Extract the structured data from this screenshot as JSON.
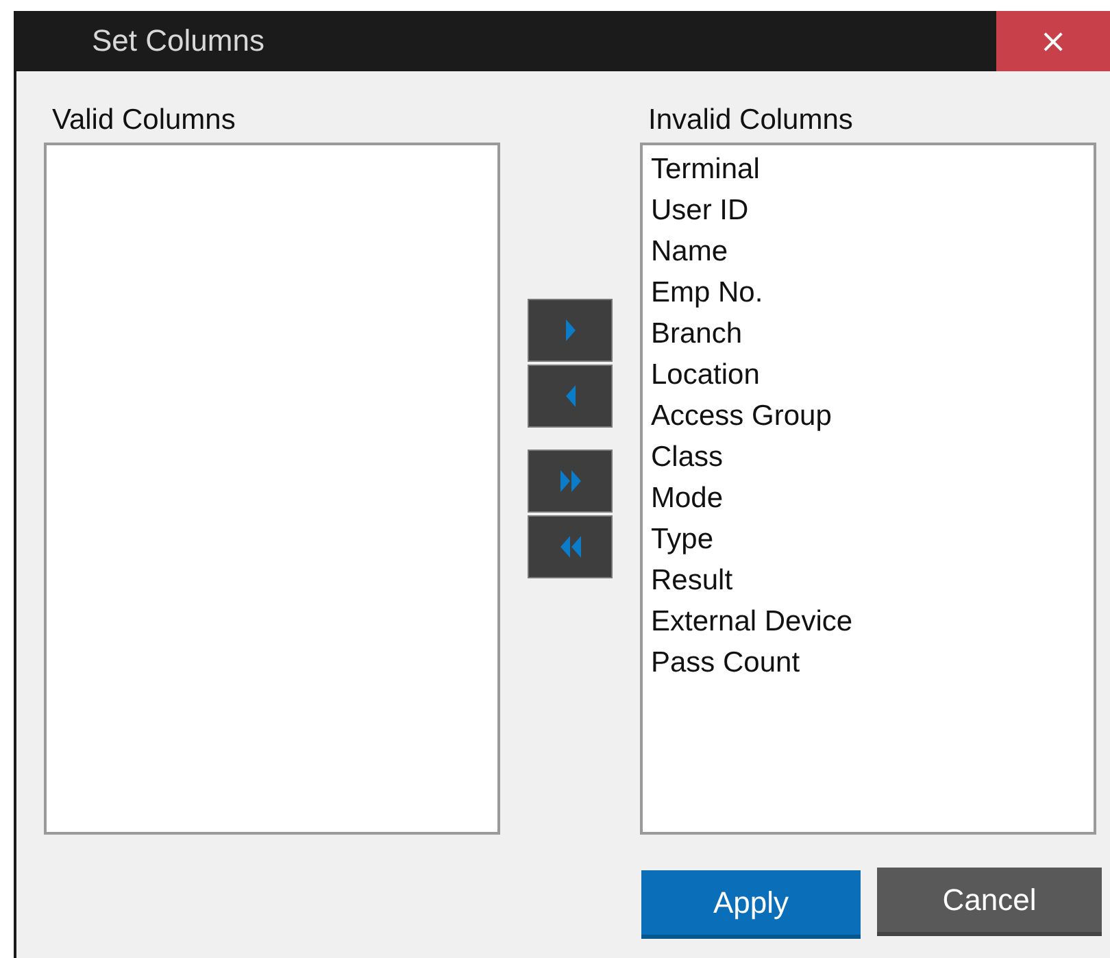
{
  "window": {
    "title": "Set Columns",
    "close": "×"
  },
  "valid_columns": {
    "label": "Valid Columns"
  },
  "invalid_columns": {
    "label": "Invalid Columns",
    "items": [
      "Terminal",
      "User ID",
      "Name",
      "Emp No.",
      "Branch",
      "Location",
      "Access Group",
      "Class",
      "Mode",
      "Type",
      "Result",
      "External Device",
      "Pass Count"
    ]
  },
  "move_buttons": [
    {
      "kind": "right"
    },
    {
      "kind": "left"
    },
    {
      "kind": "all-right"
    },
    {
      "kind": "all-left"
    }
  ],
  "buttons": [
    {
      "label": "Apply",
      "kind": "primary"
    },
    {
      "label": "Cancel",
      "kind": "secondary"
    }
  ]
}
